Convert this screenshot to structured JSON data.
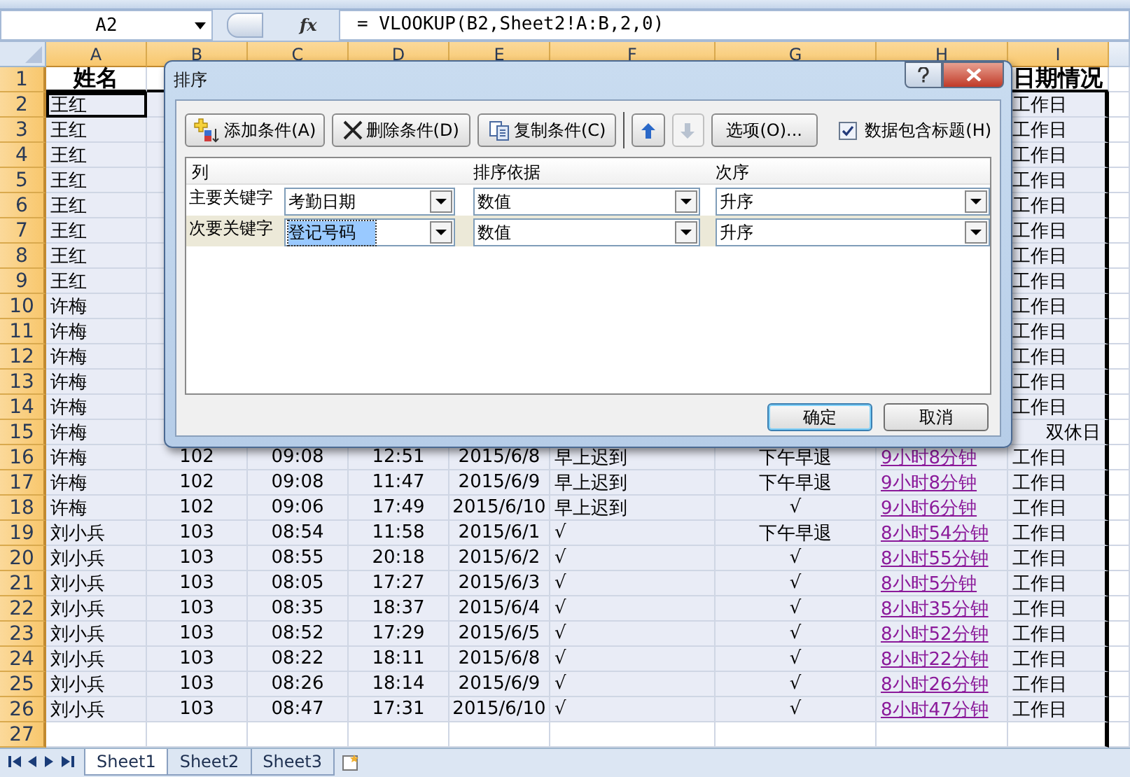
{
  "name_box": "A2",
  "fx": "fx",
  "formula": "= VLOOKUP(B2,Sheet2!A:B,2,0)",
  "columns": [
    "A",
    "B",
    "C",
    "D",
    "E",
    "F",
    "G",
    "H",
    "I"
  ],
  "rows": [
    {
      "num": "1",
      "kind": "title",
      "cells": [
        "姓名",
        null,
        null,
        null,
        null,
        null,
        null,
        null,
        "日期情况"
      ]
    },
    {
      "num": "2",
      "kind": "data",
      "active": true,
      "cells": [
        "王红",
        null,
        null,
        null,
        null,
        null,
        null,
        null,
        "工作日"
      ]
    },
    {
      "num": "3",
      "kind": "data",
      "cells": [
        "王红",
        null,
        null,
        null,
        null,
        null,
        null,
        null,
        "工作日"
      ]
    },
    {
      "num": "4",
      "kind": "data",
      "cells": [
        "王红",
        null,
        null,
        null,
        null,
        null,
        null,
        null,
        "工作日"
      ]
    },
    {
      "num": "5",
      "kind": "data",
      "cells": [
        "王红",
        null,
        null,
        null,
        null,
        null,
        null,
        null,
        "工作日"
      ]
    },
    {
      "num": "6",
      "kind": "data",
      "cells": [
        "王红",
        null,
        null,
        null,
        null,
        null,
        null,
        null,
        "工作日"
      ]
    },
    {
      "num": "7",
      "kind": "data",
      "cells": [
        "王红",
        null,
        null,
        null,
        null,
        null,
        null,
        null,
        "工作日"
      ]
    },
    {
      "num": "8",
      "kind": "data",
      "cells": [
        "王红",
        null,
        null,
        null,
        null,
        null,
        null,
        null,
        "工作日"
      ]
    },
    {
      "num": "9",
      "kind": "data",
      "cells": [
        "王红",
        null,
        null,
        null,
        null,
        null,
        null,
        null,
        "工作日"
      ]
    },
    {
      "num": "10",
      "kind": "data",
      "cells": [
        "许梅",
        null,
        null,
        null,
        null,
        null,
        null,
        null,
        "工作日"
      ]
    },
    {
      "num": "11",
      "kind": "data",
      "cells": [
        "许梅",
        null,
        null,
        null,
        null,
        null,
        null,
        null,
        "工作日"
      ]
    },
    {
      "num": "12",
      "kind": "data",
      "cells": [
        "许梅",
        null,
        null,
        null,
        null,
        null,
        null,
        null,
        "工作日"
      ]
    },
    {
      "num": "13",
      "kind": "data",
      "cells": [
        "许梅",
        null,
        null,
        null,
        null,
        null,
        null,
        null,
        "工作日"
      ]
    },
    {
      "num": "14",
      "kind": "data",
      "cells": [
        "许梅",
        null,
        null,
        null,
        null,
        null,
        null,
        null,
        "工作日"
      ]
    },
    {
      "num": "15",
      "kind": "data",
      "last_right": true,
      "cells": [
        "许梅",
        null,
        null,
        null,
        null,
        null,
        null,
        null,
        "双休日"
      ]
    },
    {
      "num": "16",
      "kind": "data",
      "cells": [
        "许梅",
        "102",
        "09:08",
        "12:51",
        "2015/6/8",
        "早上迟到",
        "下午早退",
        "9小时8分钟",
        "工作日"
      ]
    },
    {
      "num": "17",
      "kind": "data",
      "cells": [
        "许梅",
        "102",
        "09:08",
        "11:47",
        "2015/6/9",
        "早上迟到",
        "下午早退",
        "9小时8分钟",
        "工作日"
      ]
    },
    {
      "num": "18",
      "kind": "data",
      "cells": [
        "许梅",
        "102",
        "09:06",
        "17:49",
        "2015/6/10",
        "早上迟到",
        "√",
        "9小时6分钟",
        "工作日"
      ]
    },
    {
      "num": "19",
      "kind": "data",
      "cells": [
        "刘小兵",
        "103",
        "08:54",
        "11:58",
        "2015/6/1",
        "√",
        "下午早退",
        "8小时54分钟",
        "工作日"
      ]
    },
    {
      "num": "20",
      "kind": "data",
      "cells": [
        "刘小兵",
        "103",
        "08:55",
        "20:18",
        "2015/6/2",
        "√",
        "√",
        "8小时55分钟",
        "工作日"
      ]
    },
    {
      "num": "21",
      "kind": "data",
      "cells": [
        "刘小兵",
        "103",
        "08:05",
        "17:27",
        "2015/6/3",
        "√",
        "√",
        "8小时5分钟",
        "工作日"
      ]
    },
    {
      "num": "22",
      "kind": "data",
      "cells": [
        "刘小兵",
        "103",
        "08:35",
        "18:37",
        "2015/6/4",
        "√",
        "√",
        "8小时35分钟",
        "工作日"
      ]
    },
    {
      "num": "23",
      "kind": "data",
      "cells": [
        "刘小兵",
        "103",
        "08:52",
        "17:29",
        "2015/6/5",
        "√",
        "√",
        "8小时52分钟",
        "工作日"
      ]
    },
    {
      "num": "24",
      "kind": "data",
      "cells": [
        "刘小兵",
        "103",
        "08:22",
        "18:11",
        "2015/6/8",
        "√",
        "√",
        "8小时22分钟",
        "工作日"
      ]
    },
    {
      "num": "25",
      "kind": "data",
      "cells": [
        "刘小兵",
        "103",
        "08:26",
        "18:14",
        "2015/6/9",
        "√",
        "√",
        "8小时26分钟",
        "工作日"
      ]
    },
    {
      "num": "26",
      "kind": "data",
      "cells": [
        "刘小兵",
        "103",
        "08:47",
        "17:31",
        "2015/6/10",
        "√",
        "√",
        "8小时47分钟",
        "工作日"
      ]
    },
    {
      "num": "27",
      "kind": "empty",
      "cells": [
        null,
        null,
        null,
        null,
        null,
        null,
        null,
        null,
        null
      ]
    }
  ],
  "dialog": {
    "title": "排序",
    "toolbar": [
      {
        "kind": "add",
        "label": "添加条件(A)"
      },
      {
        "kind": "delete",
        "label": "删除条件(D)"
      },
      {
        "kind": "copy",
        "label": "复制条件(C)"
      },
      {
        "kind": "up",
        "disabled": false
      },
      {
        "kind": "down",
        "disabled": true
      },
      {
        "kind": "text",
        "label": "选项(O)..."
      }
    ],
    "header_checkbox": {
      "label": "数据包含标题(H)",
      "checked": true
    },
    "table_headers": [
      "列",
      "排序依据",
      "次序"
    ],
    "levels": [
      {
        "label": "主要关键字",
        "column": "考勤日期",
        "basis": "数值",
        "order": "升序",
        "selected": false
      },
      {
        "label": "次要关键字",
        "column": "登记号码",
        "basis": "数值",
        "order": "升序",
        "selected": true
      }
    ],
    "ok": "确定",
    "cancel": "取消"
  },
  "sheets": [
    {
      "label": "Sheet1",
      "selected": true
    },
    {
      "label": "Sheet2",
      "selected": false
    },
    {
      "label": "Sheet3",
      "selected": false
    }
  ]
}
